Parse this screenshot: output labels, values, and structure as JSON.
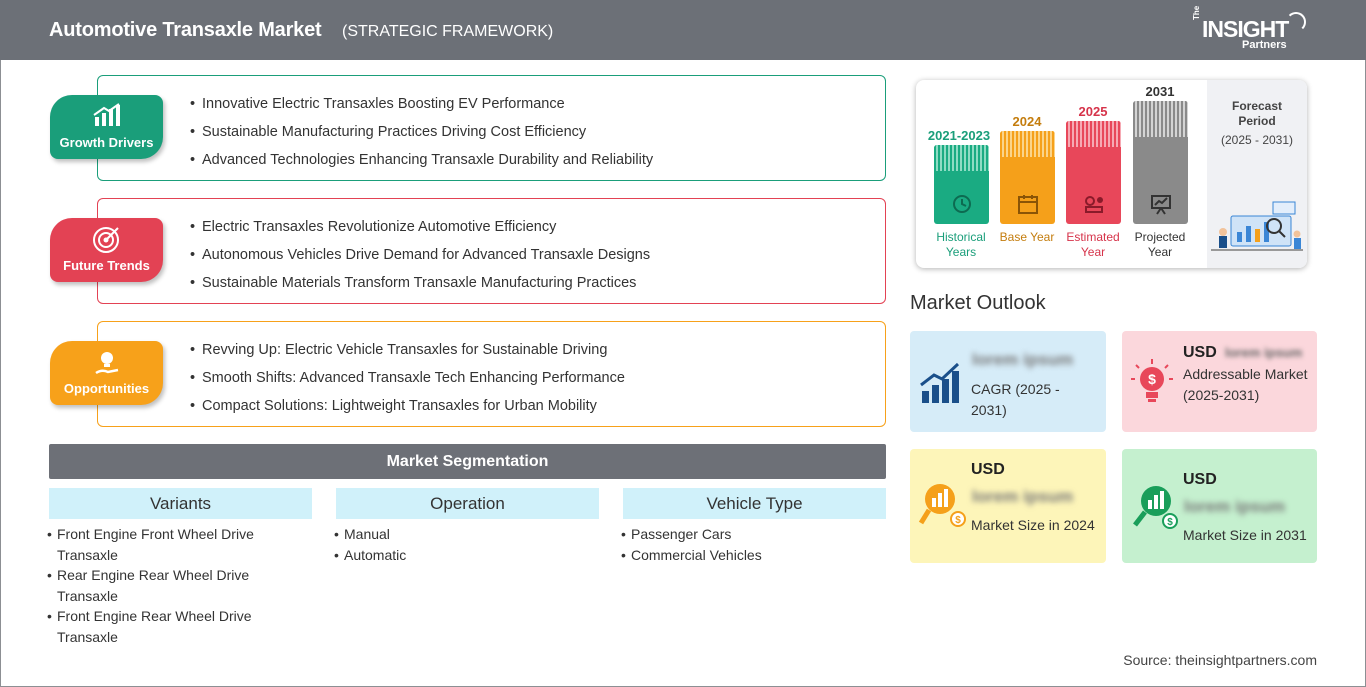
{
  "header": {
    "title": "Automotive Transaxle Market",
    "subtitle": "(STRATEGIC FRAMEWORK)",
    "logo": {
      "the": "The",
      "insight": "INSIGHT",
      "partners": "Partners"
    }
  },
  "growth_drivers": {
    "label": "Growth Drivers",
    "color": "#1a9e7a",
    "items": [
      "Innovative Electric Transaxles Boosting EV Performance",
      "Sustainable Manufacturing Practices Driving Cost Efficiency",
      "Advanced Technologies Enhancing Transaxle Durability and Reliability"
    ]
  },
  "future_trends": {
    "label": "Future Trends",
    "color": "#e34254",
    "items": [
      "Electric Transaxles Revolutionize Automotive Efficiency",
      "Autonomous Vehicles Drive Demand for Advanced Transaxle Designs",
      "Sustainable Materials Transform Transaxle Manufacturing Practices"
    ]
  },
  "opportunities": {
    "label": "Opportunities",
    "color": "#f7a11a",
    "items": [
      "Revving Up: Electric Vehicle Transaxles for Sustainable Driving",
      "Smooth Shifts: Advanced Transaxle Tech Enhancing Performance",
      "Compact Solutions: Lightweight Transaxles for Urban Mobility"
    ]
  },
  "segmentation": {
    "title": "Market Segmentation",
    "columns": [
      {
        "header": "Variants",
        "items": [
          "Front Engine Front Wheel Drive Transaxle",
          "Rear Engine Rear Wheel Drive Transaxle",
          "Front Engine Rear Wheel Drive Transaxle"
        ]
      },
      {
        "header": "Operation",
        "items": [
          "Manual",
          "Automatic"
        ]
      },
      {
        "header": "Vehicle Type",
        "items": [
          "Passenger Cars",
          "Commercial Vehicles"
        ]
      }
    ]
  },
  "timeline": {
    "forecast_label": "Forecast Period",
    "forecast_years": "(2025 - 2031)",
    "bars": [
      {
        "year": "2021-2023",
        "label": "Historical Years",
        "color": "#1aab82",
        "icon": "history-icon"
      },
      {
        "year": "2024",
        "label": "Base Year",
        "color": "#f5a01a",
        "icon": "calendar-icon"
      },
      {
        "year": "2025",
        "label": "Estimated Year",
        "color": "#e8475a",
        "icon": "estimate-icon"
      },
      {
        "year": "2031",
        "label": "Projected Year",
        "color": "#8a8a8a",
        "icon": "presentation-icon"
      }
    ]
  },
  "outlook": {
    "title": "Market Outlook",
    "cagr": {
      "value": "lorem ipsum",
      "label": "CAGR (2025 - 2031)",
      "color": "#d6ecf8"
    },
    "addressable": {
      "currency": "USD",
      "value": "lorem ipsum",
      "label": "Addressable Market (2025-2031)",
      "color": "#fbd7dc"
    },
    "size2024": {
      "currency": "USD",
      "value": "lorem ipsum",
      "label": "Market Size in 2024",
      "color": "#fdf5b9"
    },
    "size2031": {
      "currency": "USD",
      "value": "lorem ipsum",
      "label": "Market Size in 2031",
      "color": "#c5f0cf"
    }
  },
  "source": "Source: theinsightpartners.com"
}
